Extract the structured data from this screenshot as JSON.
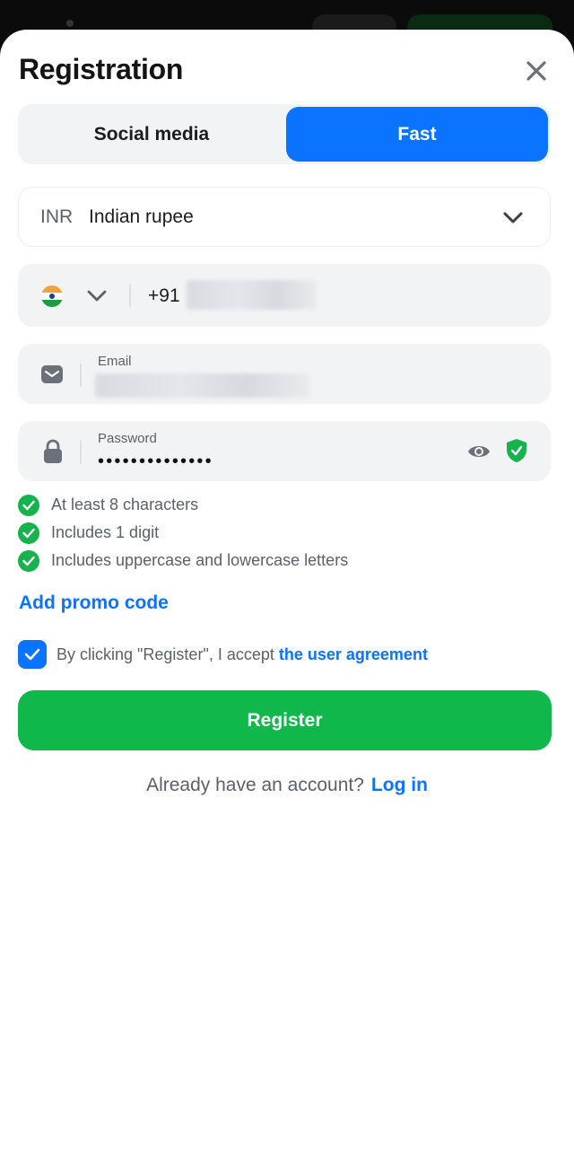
{
  "title": "Registration",
  "tabs": [
    {
      "label": "Social media",
      "active": false
    },
    {
      "label": "Fast",
      "active": true
    }
  ],
  "currency": {
    "code": "INR",
    "name": "Indian rupee"
  },
  "phone": {
    "country_code": "+91",
    "country_flag": "india-flag-icon"
  },
  "email": {
    "label": "Email"
  },
  "password": {
    "label": "Password",
    "value": "••••••••••••••"
  },
  "rules": [
    "At least 8 characters",
    "Includes 1 digit",
    "Includes uppercase and lowercase letters"
  ],
  "promo": {
    "label": "Add promo code"
  },
  "agreement": {
    "text": "By clicking \"Register\", I accept",
    "link": "the user agreement",
    "checked": true
  },
  "register_label": "Register",
  "login_prompt": {
    "text": "Already have an account?",
    "link": "Log in"
  },
  "colors": {
    "accent": "#0a73ff",
    "success": "#10b84b",
    "field_bg": "#f2f3f5"
  }
}
